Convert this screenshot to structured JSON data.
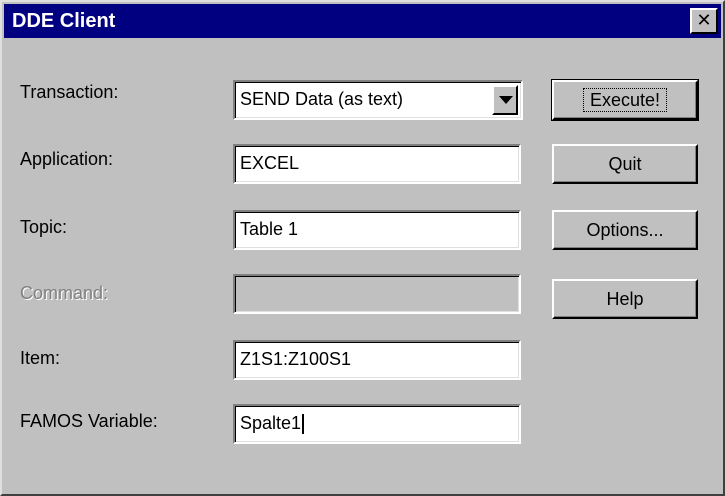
{
  "window": {
    "title": "DDE Client",
    "close_glyph": "✕"
  },
  "labels": {
    "transaction": "Transaction:",
    "application": "Application:",
    "topic": "Topic:",
    "command": "Command:",
    "item": "Item:",
    "famos_variable": "FAMOS Variable:"
  },
  "fields": {
    "transaction": "SEND Data (as text)",
    "application": "EXCEL",
    "topic": "Table 1",
    "command": "",
    "item": "Z1S1:Z100S1",
    "famos_variable": "Spalte1"
  },
  "buttons": {
    "execute": "Execute!",
    "quit": "Quit",
    "options": "Options...",
    "help": "Help"
  },
  "colors": {
    "titlebar": "#000080",
    "face": "#c0c0c0"
  }
}
